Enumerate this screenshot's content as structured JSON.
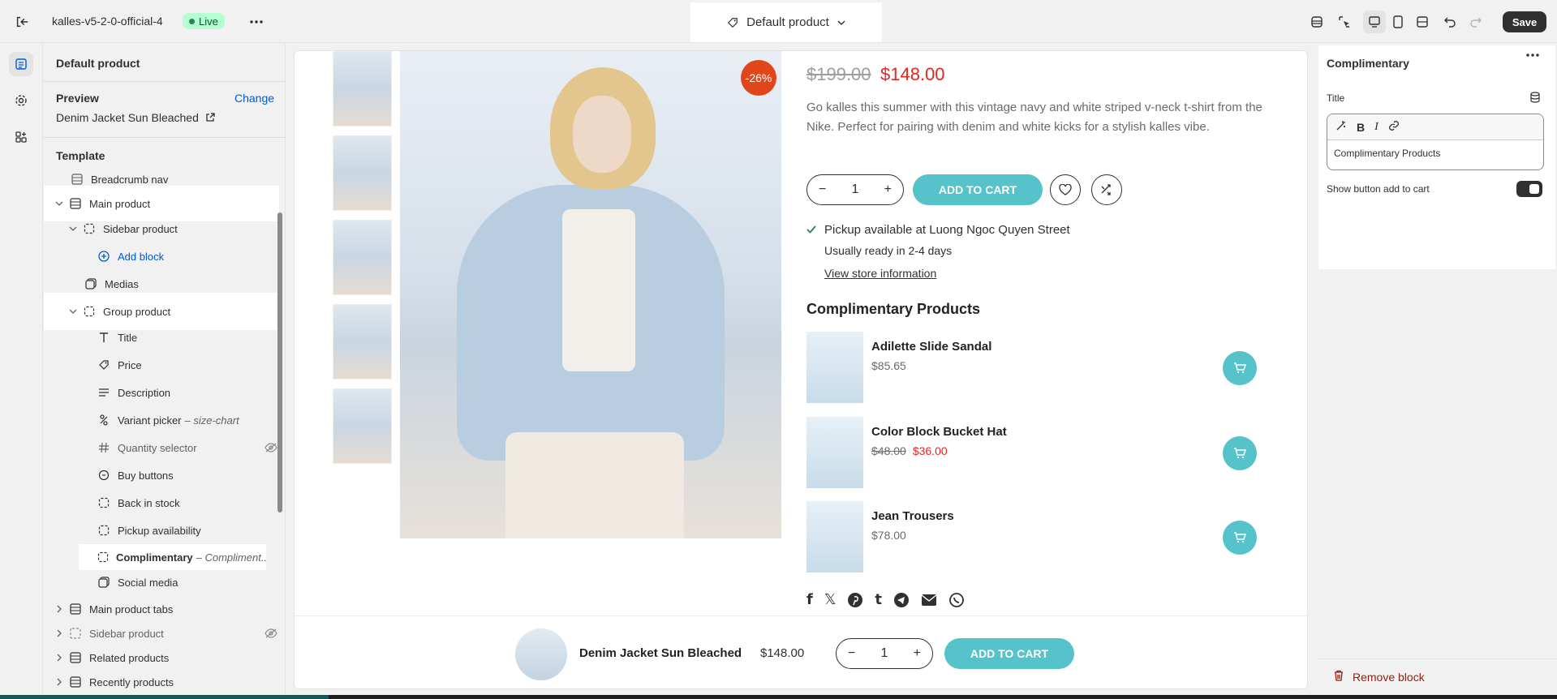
{
  "topbar": {
    "store_name": "kalles-v5-2-0-official-4",
    "status": "Live",
    "template_selector": "Default product",
    "save_label": "Save"
  },
  "sidebar": {
    "title": "Default product",
    "preview_label": "Preview",
    "change_label": "Change",
    "preview_product": "Denim Jacket Sun Bleached",
    "template_label": "Template",
    "tree": [
      {
        "label": "Breadcrumb nav",
        "sub": ""
      },
      {
        "label": "Main product",
        "sub": ""
      },
      {
        "label": "Sidebar product",
        "sub": ""
      },
      {
        "label": "Add block",
        "sub": ""
      },
      {
        "label": "Medias",
        "sub": ""
      },
      {
        "label": "Group product",
        "sub": ""
      },
      {
        "label": "Title",
        "sub": ""
      },
      {
        "label": "Price",
        "sub": ""
      },
      {
        "label": "Description",
        "sub": ""
      },
      {
        "label": "Variant picker",
        "sub": "– size-chart"
      },
      {
        "label": "Quantity selector",
        "sub": ""
      },
      {
        "label": "Buy buttons",
        "sub": ""
      },
      {
        "label": "Back in stock",
        "sub": ""
      },
      {
        "label": "Pickup availability",
        "sub": ""
      },
      {
        "label": "Complimentary",
        "sub": "– Compliment..."
      },
      {
        "label": "Social media",
        "sub": ""
      },
      {
        "label": "Main product tabs",
        "sub": ""
      },
      {
        "label": "Sidebar product",
        "sub": ""
      },
      {
        "label": "Related products",
        "sub": ""
      },
      {
        "label": "Recently products",
        "sub": ""
      }
    ]
  },
  "product": {
    "discount_badge": "-26%",
    "old_price": "$199.00",
    "new_price": "$148.00",
    "description": "Go kalles this summer with this vintage navy and white striped v-neck t-shirt from the Nike. Perfect for pairing with denim and white kicks for a stylish kalles vibe.",
    "quantity": "1",
    "add_to_cart": "ADD TO CART",
    "pickup": "Pickup available at Luong Ngoc Quyen Street",
    "ready": "Usually ready in 2-4 days",
    "store_link": "View store information"
  },
  "complimentary": {
    "title": "Complimentary Products",
    "items": [
      {
        "name": "Adilette Slide Sandal",
        "price": "$85.65",
        "old_price": "",
        "sale_price": ""
      },
      {
        "name": "Color Block Bucket Hat",
        "price": "",
        "old_price": "$48.00",
        "sale_price": "$36.00"
      },
      {
        "name": "Jean Trousers",
        "price": "$78.00",
        "old_price": "",
        "sale_price": ""
      }
    ]
  },
  "sticky": {
    "name": "Denim Jacket Sun Bleached",
    "price": "$148.00",
    "quantity": "1",
    "add_to_cart": "ADD TO CART"
  },
  "settings": {
    "title": "Complimentary",
    "title_label": "Title",
    "title_value": "Complimentary Products",
    "toggle_label": "Show button add to cart",
    "toggle_on": true,
    "remove_label": "Remove block"
  },
  "colors": {
    "accent": "#56c2c9",
    "sale": "#e3261e",
    "badge": "#e1461b",
    "link": "#005bd3"
  }
}
